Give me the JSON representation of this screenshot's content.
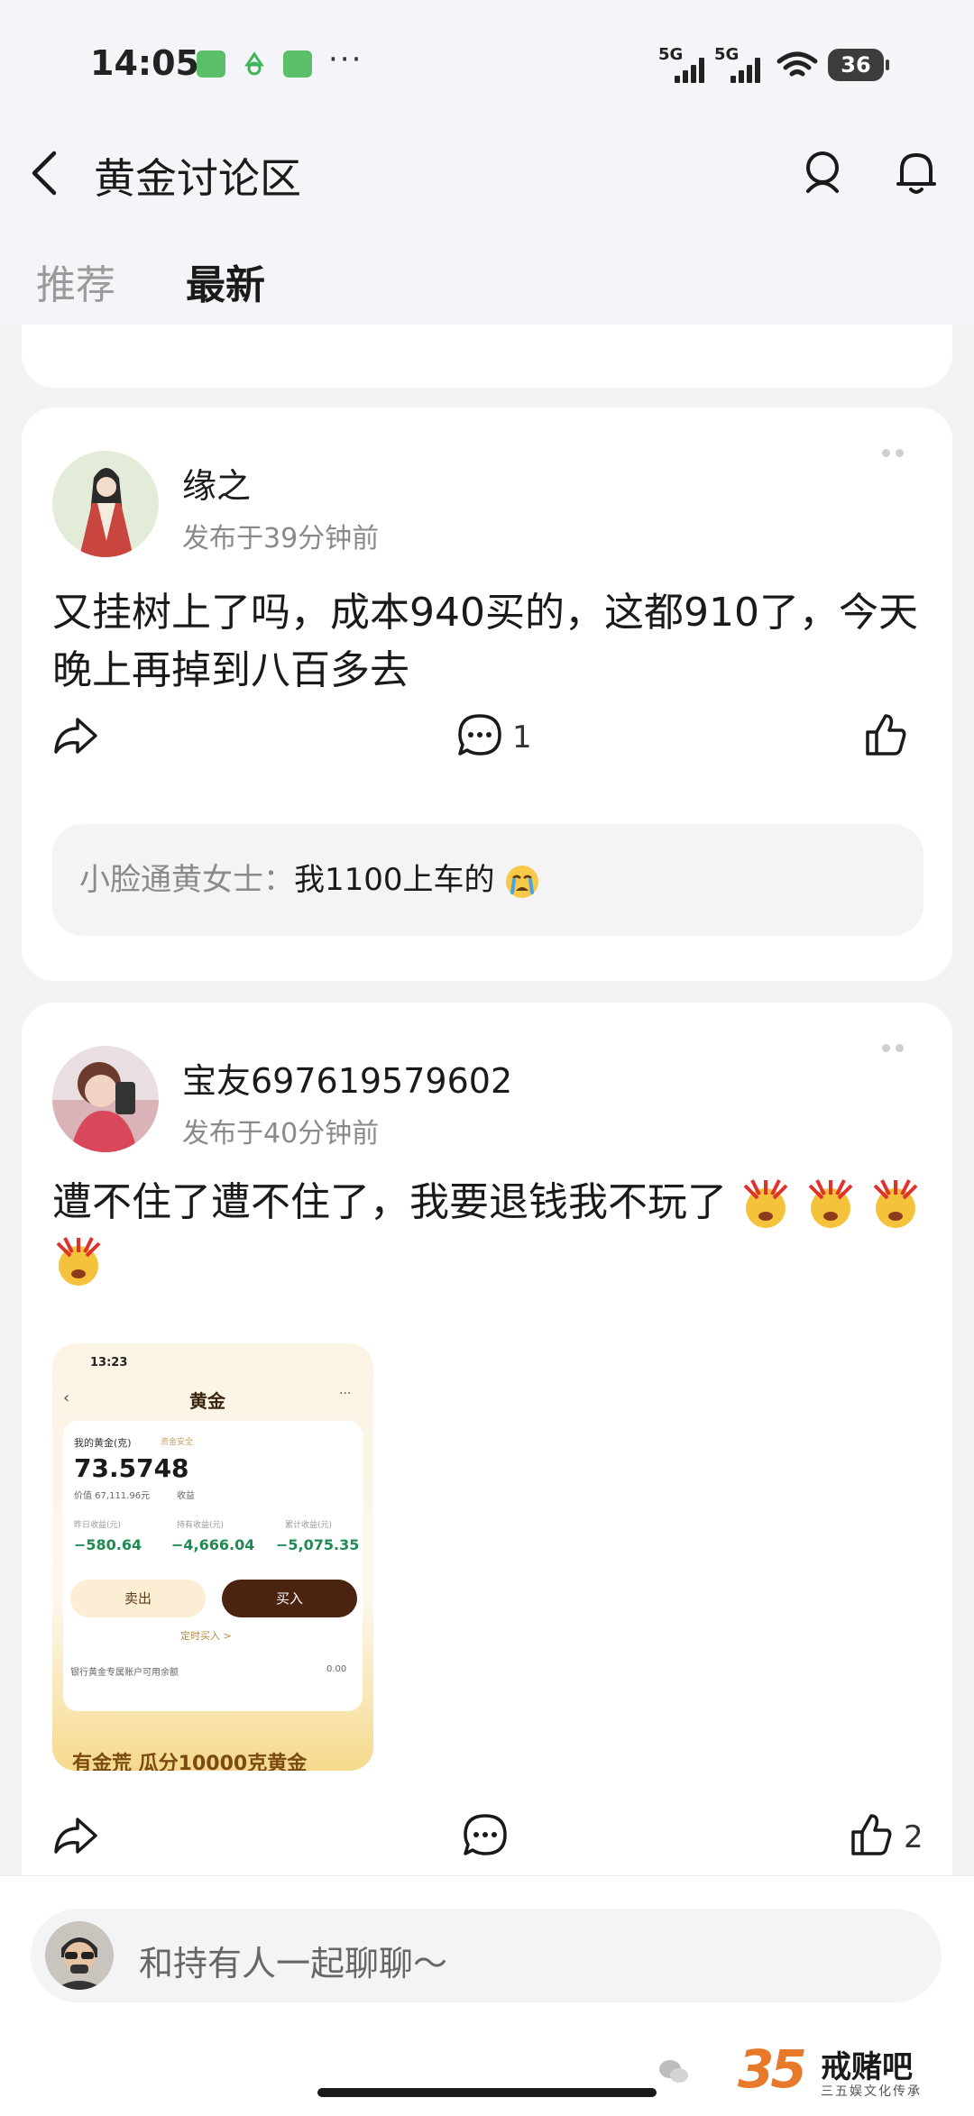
{
  "status_bar": {
    "time": "14:05",
    "network_1": "5G",
    "network_2": "5G",
    "battery": "36"
  },
  "header": {
    "title": "黄金讨论区"
  },
  "tabs": [
    {
      "label": "推荐",
      "active": false
    },
    {
      "label": "最新",
      "active": true
    }
  ],
  "posts": [
    {
      "username": "缘之",
      "time": "发布于39分钟前",
      "text": "又挂树上了吗，成本940买的，这都910了，今天晚上再掉到八百多去",
      "comment_count": "1",
      "like_count": "",
      "reply": {
        "name": "小脸通黄女士：",
        "text": "我1100上车的"
      }
    },
    {
      "username": "宝友697619579602",
      "time": "发布于40分钟前",
      "text": "遭不住了遭不住了，我要退钱我不玩了",
      "comment_count": "",
      "like_count": "2",
      "screenshot": {
        "time": "13:23",
        "title": "黄金",
        "holding_label": "我的黄金(克)",
        "safety_label": "资金安全",
        "grams": "73.5748",
        "value_line": "价值 67,111.96元",
        "income_label": "收益",
        "col1_label": "昨日收益(元)",
        "col1_value": "−580.64",
        "col2_label": "持有收益(元)",
        "col2_value": "−4,666.04",
        "col3_label": "累计收益(元)",
        "col3_value": "−5,075.35",
        "sell_label": "卖出",
        "buy_label": "买入",
        "scheduled_label": "定时买入 >",
        "bank_label": "银行黄金专属账户可用余额",
        "bank_value": "0.00",
        "banner_text": "有金荒 瓜分10000克黄金"
      }
    }
  ],
  "bottom_bar": {
    "placeholder": "和持有人一起聊聊～"
  },
  "watermark": {
    "number": "35",
    "title": "戒赌吧",
    "subtitle": "三五娱文化传承"
  },
  "colors": {
    "background": "#f2f3f5",
    "card": "#ffffff",
    "muted_text": "#8a8a8a",
    "loss_green": "#1f8a52",
    "buy_button": "#4a2410"
  }
}
